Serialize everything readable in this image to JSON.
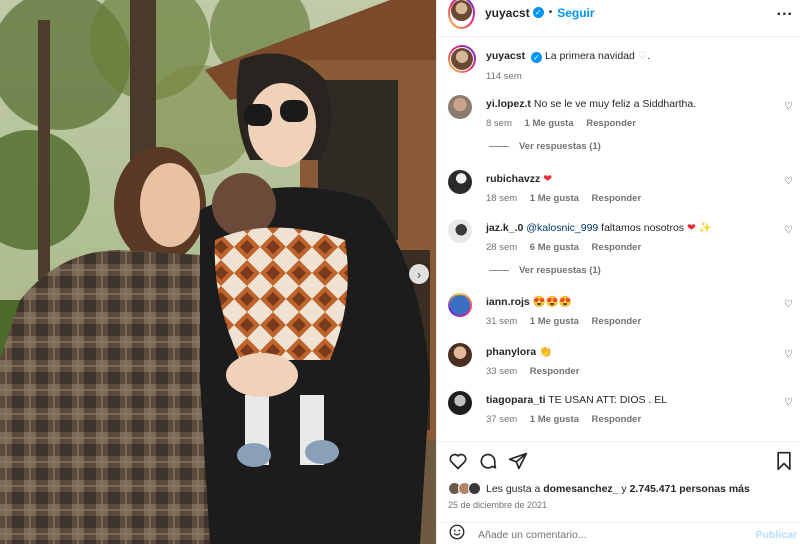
{
  "post": {
    "author": "yuyacst",
    "follow_label": "Seguir",
    "more_label": "...",
    "caption": "La primera navidad",
    "caption_emoji": "♡",
    "caption_end": ".",
    "caption_time": "114 sem"
  },
  "comments": [
    {
      "user": "yi.lopez.t",
      "text": "No se le ve muy feliz a Siddhartha.",
      "time": "8 sem",
      "likes": "1 Me gusta",
      "reply": "Responder",
      "replies": "Ver respuestas (1)"
    },
    {
      "user": "rubichavzz",
      "text": "❤",
      "time": "18 sem",
      "likes": "1 Me gusta",
      "reply": "Responder"
    },
    {
      "user": "jaz.k_.0",
      "mention": "@kalosnic_999",
      "text": "faltamos nosotros",
      "emoji": "❤ ✨",
      "time": "28 sem",
      "likes": "6 Me gusta",
      "reply": "Responder",
      "replies": "Ver respuestas (1)"
    },
    {
      "user": "iann.rojs",
      "text": "😍😍😍",
      "time": "31 sem",
      "likes": "1 Me gusta",
      "reply": "Responder"
    },
    {
      "user": "phanylora",
      "text": "👏",
      "time": "33 sem",
      "reply": "Responder"
    },
    {
      "user": "tiagopara_ti",
      "text": "TE USAN ATT: DIOS . EL",
      "time": "37 sem",
      "likes": "1 Me gusta",
      "reply": "Responder"
    }
  ],
  "likes": {
    "prefix": "Les gusta a",
    "user": "domesanchez_",
    "middle": "y",
    "count": "2.745.471 personas más"
  },
  "date": "25 de diciembre de 2021",
  "comment_input": {
    "placeholder": "Añade un comentario...",
    "publish": "Publicar"
  },
  "icons": [
    "heart-icon",
    "comment-icon",
    "share-icon",
    "bookmark-icon",
    "emoji-icon",
    "chevron-right-icon",
    "more-icon",
    "verified-icon"
  ],
  "colors": {
    "accent": "#0095f6",
    "heart": "#ed2d3b",
    "muted": "#737373",
    "text": "#262626"
  }
}
